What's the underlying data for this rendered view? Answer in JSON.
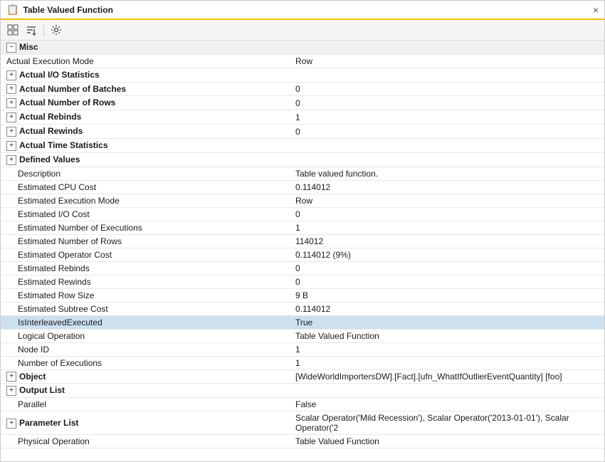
{
  "window": {
    "title": "Table Valued Function",
    "close_label": "×"
  },
  "toolbar": {
    "btn1": "⊞",
    "btn2": "↓",
    "btn3": "🔧"
  },
  "sections": [
    {
      "id": "misc",
      "label": "Misc",
      "type": "section",
      "rows": [
        {
          "label": "Actual Execution Mode",
          "value": "Row",
          "value_class": ""
        },
        {
          "label": "Actual I/O Statistics",
          "value": "",
          "value_class": "",
          "type": "expandable"
        },
        {
          "label": "Actual Number of Batches",
          "value": "0",
          "value_class": "value-blue",
          "type": "expandable"
        },
        {
          "label": "Actual Number of Rows",
          "value": "0",
          "value_class": "value-blue",
          "type": "expandable"
        },
        {
          "label": "Actual Rebinds",
          "value": "1",
          "value_class": "value-blue",
          "type": "expandable"
        },
        {
          "label": "Actual Rewinds",
          "value": "0",
          "value_class": "value-blue",
          "type": "expandable"
        },
        {
          "label": "Actual Time Statistics",
          "value": "",
          "value_class": "",
          "type": "expandable"
        },
        {
          "label": "Defined Values",
          "value": "",
          "value_class": "",
          "type": "expandable"
        },
        {
          "label": "Description",
          "value": "Table valued function.",
          "value_class": "",
          "indent": 2
        },
        {
          "label": "Estimated CPU Cost",
          "value": "0.114012",
          "value_class": "",
          "indent": 2
        },
        {
          "label": "Estimated Execution Mode",
          "value": "Row",
          "value_class": "",
          "indent": 2
        },
        {
          "label": "Estimated I/O Cost",
          "value": "0",
          "value_class": "value-blue",
          "indent": 2
        },
        {
          "label": "Estimated Number of Executions",
          "value": "1",
          "value_class": "value-blue",
          "indent": 2
        },
        {
          "label": "Estimated Number of Rows",
          "value": "114012",
          "value_class": "value-purple",
          "indent": 2
        },
        {
          "label": "Estimated Operator Cost",
          "value": "0.114012 (9%)",
          "value_class": "value-blue",
          "indent": 2
        },
        {
          "label": "Estimated Rebinds",
          "value": "0",
          "value_class": "value-blue",
          "indent": 2
        },
        {
          "label": "Estimated Rewinds",
          "value": "0",
          "value_class": "value-blue",
          "indent": 2
        },
        {
          "label": "Estimated Row Size",
          "value": "9 B",
          "value_class": "",
          "indent": 2
        },
        {
          "label": "Estimated Subtree Cost",
          "value": "0.114012",
          "value_class": "",
          "indent": 2
        },
        {
          "label": "IsInterleavedExecuted",
          "value": "True",
          "value_class": "",
          "indent": 2,
          "highlighted": true
        },
        {
          "label": "Logical Operation",
          "value": "Table Valued Function",
          "value_class": "",
          "indent": 2
        },
        {
          "label": "Node ID",
          "value": "1",
          "value_class": "value-blue",
          "indent": 2
        },
        {
          "label": "Number of Executions",
          "value": "1",
          "value_class": "value-blue",
          "indent": 2
        },
        {
          "label": "Object",
          "value": "[WideWorldImportersDW].[Fact].[ufn_WhatIfOutlierEventQuantity] [foo]",
          "value_class": "value-blue",
          "type": "expandable"
        },
        {
          "label": "Output List",
          "value": "",
          "value_class": "",
          "type": "expandable"
        },
        {
          "label": "Parallel",
          "value": "False",
          "value_class": "",
          "indent": 2
        },
        {
          "label": "Parameter List",
          "value": "Scalar Operator('Mild Recession'), Scalar Operator('2013-01-01'), Scalar Operator('2",
          "value_class": "value-blue",
          "type": "expandable"
        },
        {
          "label": "Physical Operation",
          "value": "Table Valued Function",
          "value_class": "",
          "indent": 2
        }
      ]
    }
  ]
}
